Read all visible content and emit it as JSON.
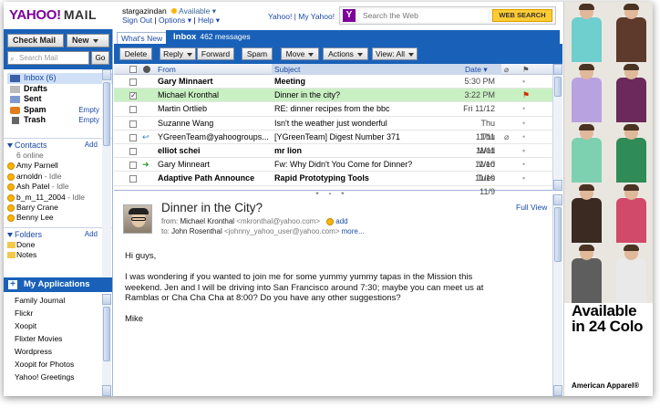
{
  "header": {
    "logo_yahoo": "YAHOO!",
    "logo_mail": "MAIL",
    "username": "stargazindan",
    "status": "Available ▾",
    "sign_out": "Sign Out",
    "options": "Options ▾",
    "help": "Help ▾",
    "separator": "|",
    "links": "Yahoo! | My Yahoo!",
    "search_placeholder": "Search the Web",
    "web_search_label": "WEB SEARCH"
  },
  "sidebar": {
    "check_mail": "Check Mail",
    "new": "New",
    "search_placeholder": "Search Mail",
    "go": "Go",
    "folders": [
      {
        "label": "Inbox (6)",
        "empty": ""
      },
      {
        "label": "Drafts",
        "empty": ""
      },
      {
        "label": "Sent",
        "empty": ""
      },
      {
        "label": "Spam",
        "empty": "Empty"
      },
      {
        "label": "Trash",
        "empty": "Empty"
      }
    ],
    "contacts_label": "Contacts",
    "contacts_add": "Add",
    "online_label": "6  online",
    "contacts": [
      {
        "name": "Amy Parnell",
        "status": ""
      },
      {
        "name": "arnoldn",
        "status": " - Idle"
      },
      {
        "name": "Ash Patel",
        "status": " - Idle"
      },
      {
        "name": "b_m_11_2004",
        "status": " - Idle"
      },
      {
        "name": "Barry Crane",
        "status": ""
      },
      {
        "name": "Benny Lee",
        "status": ""
      }
    ],
    "folders_label": "Folders",
    "folders_add": "Add",
    "custom_folders": [
      "Done",
      "Notes"
    ],
    "my_apps_label": "My Applications",
    "apps": [
      "Family Journal",
      "Flickr",
      "Xoopit",
      "Flixter Movies",
      "Wordpress",
      "Xoopit for Photos",
      "Yahoo! Greetings"
    ]
  },
  "main": {
    "tab_whats_new": "What's New",
    "tab_inbox": "Inbox",
    "inbox_count": "462 messages",
    "toolbar": {
      "delete": "Delete",
      "reply": "Reply",
      "forward": "Forward",
      "spam": "Spam",
      "move": "Move",
      "actions": "Actions",
      "view": "View: All"
    },
    "columns": {
      "from": "From",
      "subject": "Subject",
      "date": "Date"
    },
    "messages": [
      {
        "from": "Gary Minnaert",
        "subject": "Meeting",
        "date": "5:30 PM",
        "unread": true,
        "checked": false,
        "icon": "",
        "attach": false,
        "flag": "dot"
      },
      {
        "from": "Michael Kronthal",
        "subject": "Dinner in the city?",
        "date": "3:22 PM",
        "unread": false,
        "checked": true,
        "icon": "",
        "attach": false,
        "flag": "red"
      },
      {
        "from": "Martin Ortlieb",
        "subject": "RE: dinner recipes from the bbc",
        "date": "Fri 11/12",
        "unread": false,
        "checked": false,
        "icon": "",
        "attach": false,
        "flag": "dot"
      },
      {
        "from": "Suzanne Wang",
        "subject": "Isn't the weather just wonderful",
        "date": "Thu 11/11",
        "unread": false,
        "checked": false,
        "icon": "",
        "attach": false,
        "flag": "dot"
      },
      {
        "from": "YGreenTeam@yahoogroups...",
        "subject": "[YGreenTeam] Digest Number 371",
        "date": "Thu 11/11",
        "unread": false,
        "checked": false,
        "icon": "reply",
        "attach": true,
        "flag": "dot"
      },
      {
        "from": "elliot schei",
        "subject": "mr lion",
        "date": "Wed 11/10",
        "unread": true,
        "checked": false,
        "icon": "",
        "attach": false,
        "flag": "dot"
      },
      {
        "from": "Gary Minneart",
        "subject": "Fw: Why Didn't You Come for Dinner?",
        "date": "Wed 11/10",
        "unread": false,
        "checked": false,
        "icon": "fwd",
        "attach": false,
        "flag": "dot"
      },
      {
        "from": "Adaptive Path Announce",
        "subject": "Rapid Prototyping Tools",
        "date": "Tues 11/9",
        "unread": true,
        "checked": false,
        "icon": "",
        "attach": false,
        "flag": "dot"
      }
    ]
  },
  "preview": {
    "subject": "Dinner in the City?",
    "full_view": "Full View",
    "from_label": "from:",
    "from_name": "Michael Kronthal",
    "from_addr": "<mkronthal@yahoo.com>",
    "add_label": "add",
    "to_label": "to:",
    "to_name": "John Rosenthal",
    "to_addr": "<johnny_yahoo_user@yahoo.com>",
    "more_label": "more...",
    "body": [
      "Hi guys,",
      "I was wondering if you wanted to join me for some yummy yummy tapas in the Mission this weekend. Jen and I will be driving into San Francisco around 7:30; maybe you can meet us at Ramblas or Cha Cha Cha at 8:00? Do you have any other suggestions?",
      "Mike"
    ]
  },
  "ad": {
    "headline_1": "Available",
    "headline_2": "in 24 Colo",
    "brand": "American Apparel®",
    "shirt_colors": [
      "#6fcfcf",
      "#5d3a2b",
      "#b9a2e0",
      "#6b2a5b",
      "#7ed1b0",
      "#2f8c56",
      "#3a2a22",
      "#d24a6a",
      "#5e5e5e",
      "#e9e9e9"
    ]
  },
  "colors": {
    "brand_blue": "#1961b8",
    "yahoo_purple": "#7b0099",
    "selected_row": "#c9f0c2"
  }
}
